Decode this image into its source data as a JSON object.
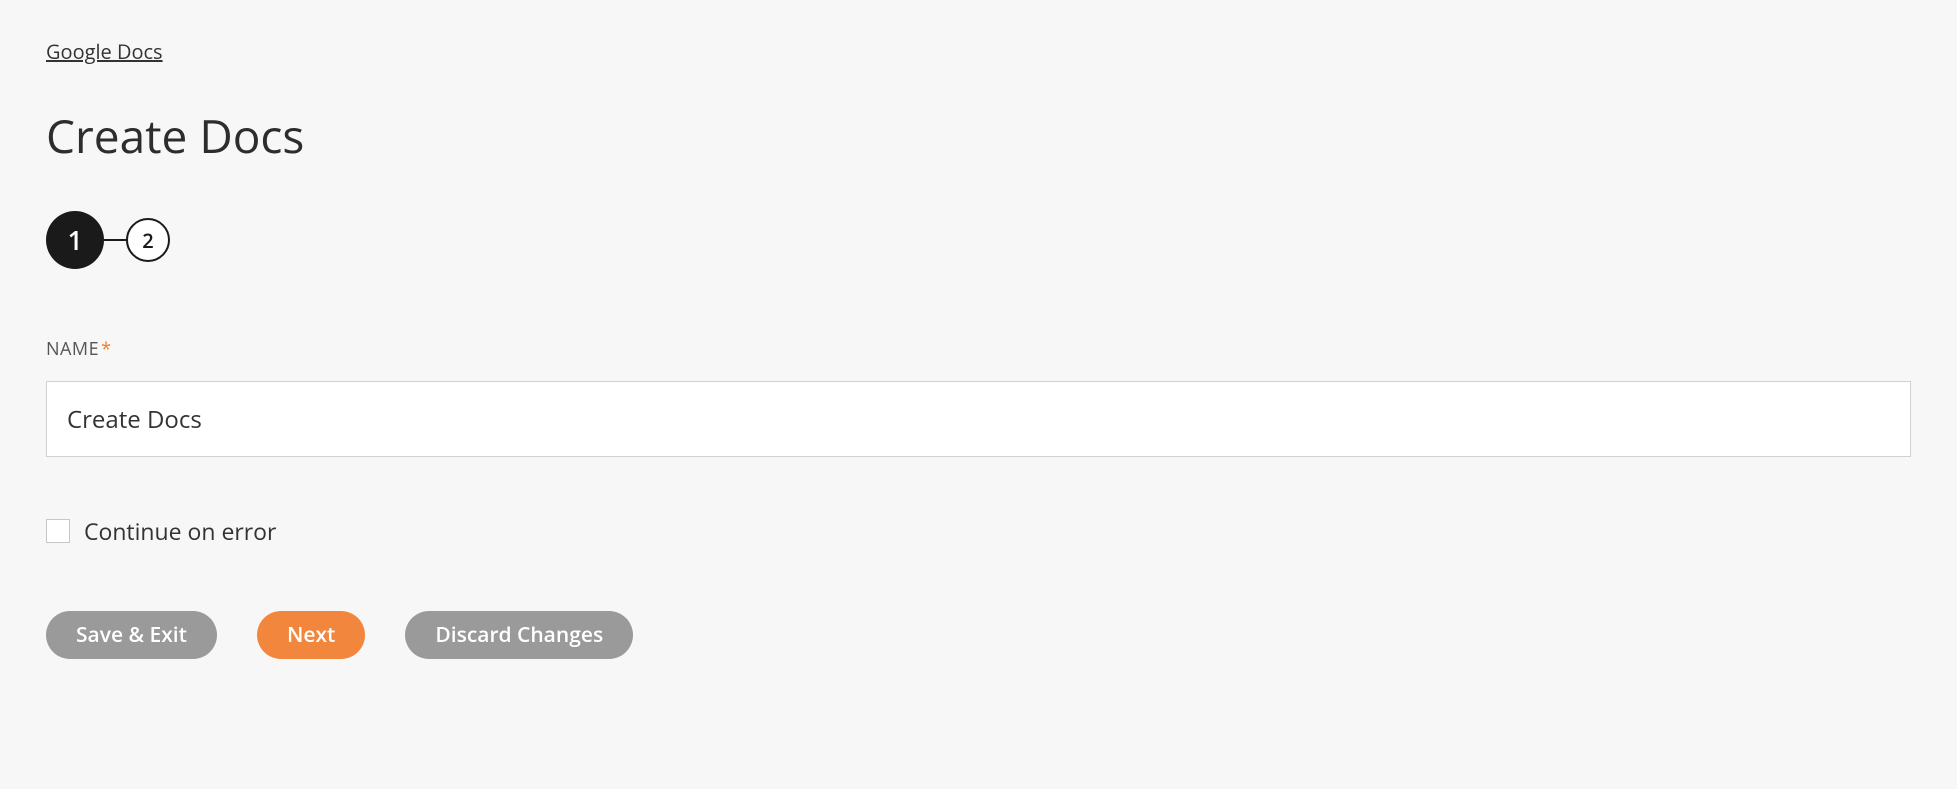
{
  "breadcrumb": {
    "label": "Google Docs"
  },
  "page": {
    "title": "Create Docs"
  },
  "stepper": {
    "steps": [
      {
        "number": "1",
        "active": true
      },
      {
        "number": "2",
        "active": false
      }
    ]
  },
  "form": {
    "name_label": "NAME",
    "required_star": "*",
    "name_value": "Create Docs",
    "continue_on_error_label": "Continue on error",
    "continue_on_error_checked": false
  },
  "buttons": {
    "save_exit": "Save & Exit",
    "next": "Next",
    "discard": "Discard Changes"
  }
}
